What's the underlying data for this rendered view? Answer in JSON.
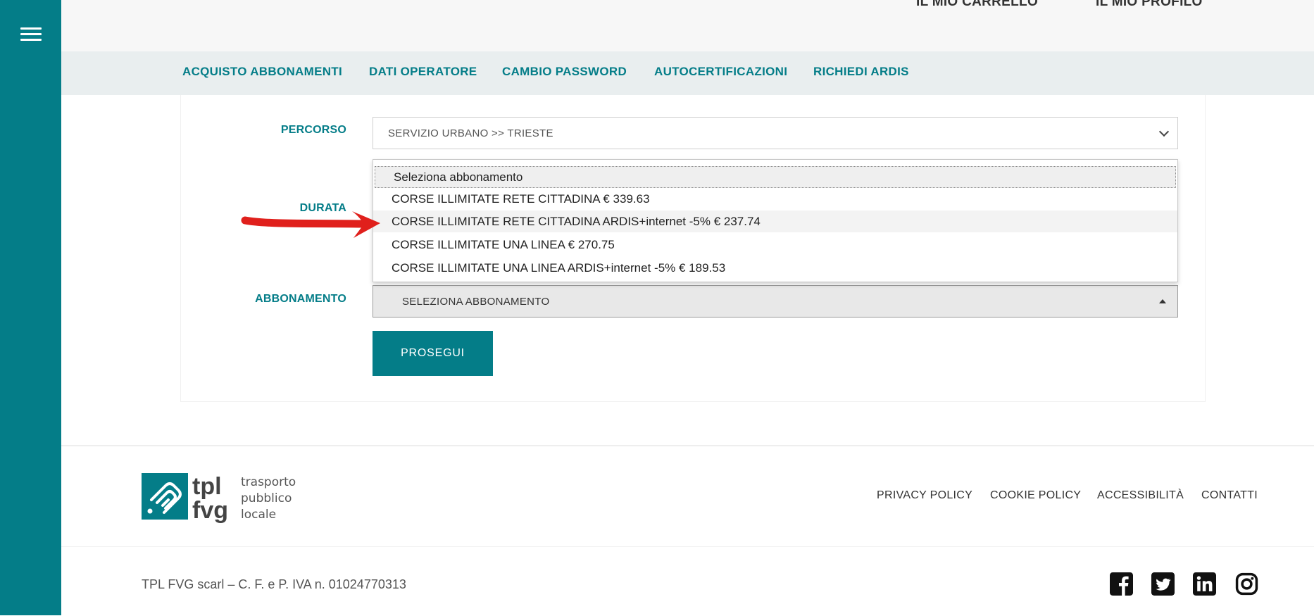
{
  "header": {
    "menu_icon": "hamburger-menu-icon",
    "cart_label": "IL MIO CARRELLO",
    "profile_label": "IL MIO PROFILO"
  },
  "nav": {
    "items": [
      {
        "label": "ACQUISTO ABBONAMENTI"
      },
      {
        "label": "DATI OPERATORE"
      },
      {
        "label": "CAMBIO PASSWORD"
      },
      {
        "label": "AUTOCERTIFICAZIONI"
      },
      {
        "label": "RICHIEDI ARDIS"
      }
    ]
  },
  "form": {
    "percorso_label": "PERCORSO",
    "percorso_value": "SERVIZIO URBANO >> TRIESTE",
    "durata_label": "DURATA",
    "abbonamento_label": "ABBONAMENTO",
    "abbonamento_value": "SELEZIONA ABBONAMENTO",
    "submit_label": "PROSEGUI"
  },
  "dropdown": {
    "options": [
      {
        "label": "Seleziona abbonamento",
        "state": "selected"
      },
      {
        "label": "CORSE ILLIMITATE RETE CITTADINA € 339.63"
      },
      {
        "label": "CORSE ILLIMITATE RETE CITTADINA ARDIS+internet -5% € 237.74",
        "state": "hover"
      },
      {
        "label": "CORSE ILLIMITATE UNA LINEA € 270.75"
      },
      {
        "label": "CORSE ILLIMITATE UNA LINEA ARDIS+internet -5% € 189.53"
      }
    ]
  },
  "annotation": {
    "color": "#e0201c",
    "icon": "red-arrow-annotation"
  },
  "footer": {
    "logo": {
      "mark": "tpl",
      "mark2": "fvg",
      "line1": "trasporto",
      "line2": "pubblico",
      "line3": "locale"
    },
    "links": [
      {
        "label": "PRIVACY POLICY"
      },
      {
        "label": "COOKIE POLICY"
      },
      {
        "label": "ACCESSIBILITÀ"
      },
      {
        "label": "CONTATTI"
      }
    ],
    "legal": "TPL FVG scarl – C. F. e P. IVA n. 01024770313",
    "social": [
      "facebook-icon",
      "twitter-icon",
      "linkedin-icon",
      "instagram-icon"
    ]
  },
  "colors": {
    "brand": "#047d88",
    "nav_bg": "#e9eeef",
    "topbar_bg": "#f7f7f7"
  }
}
